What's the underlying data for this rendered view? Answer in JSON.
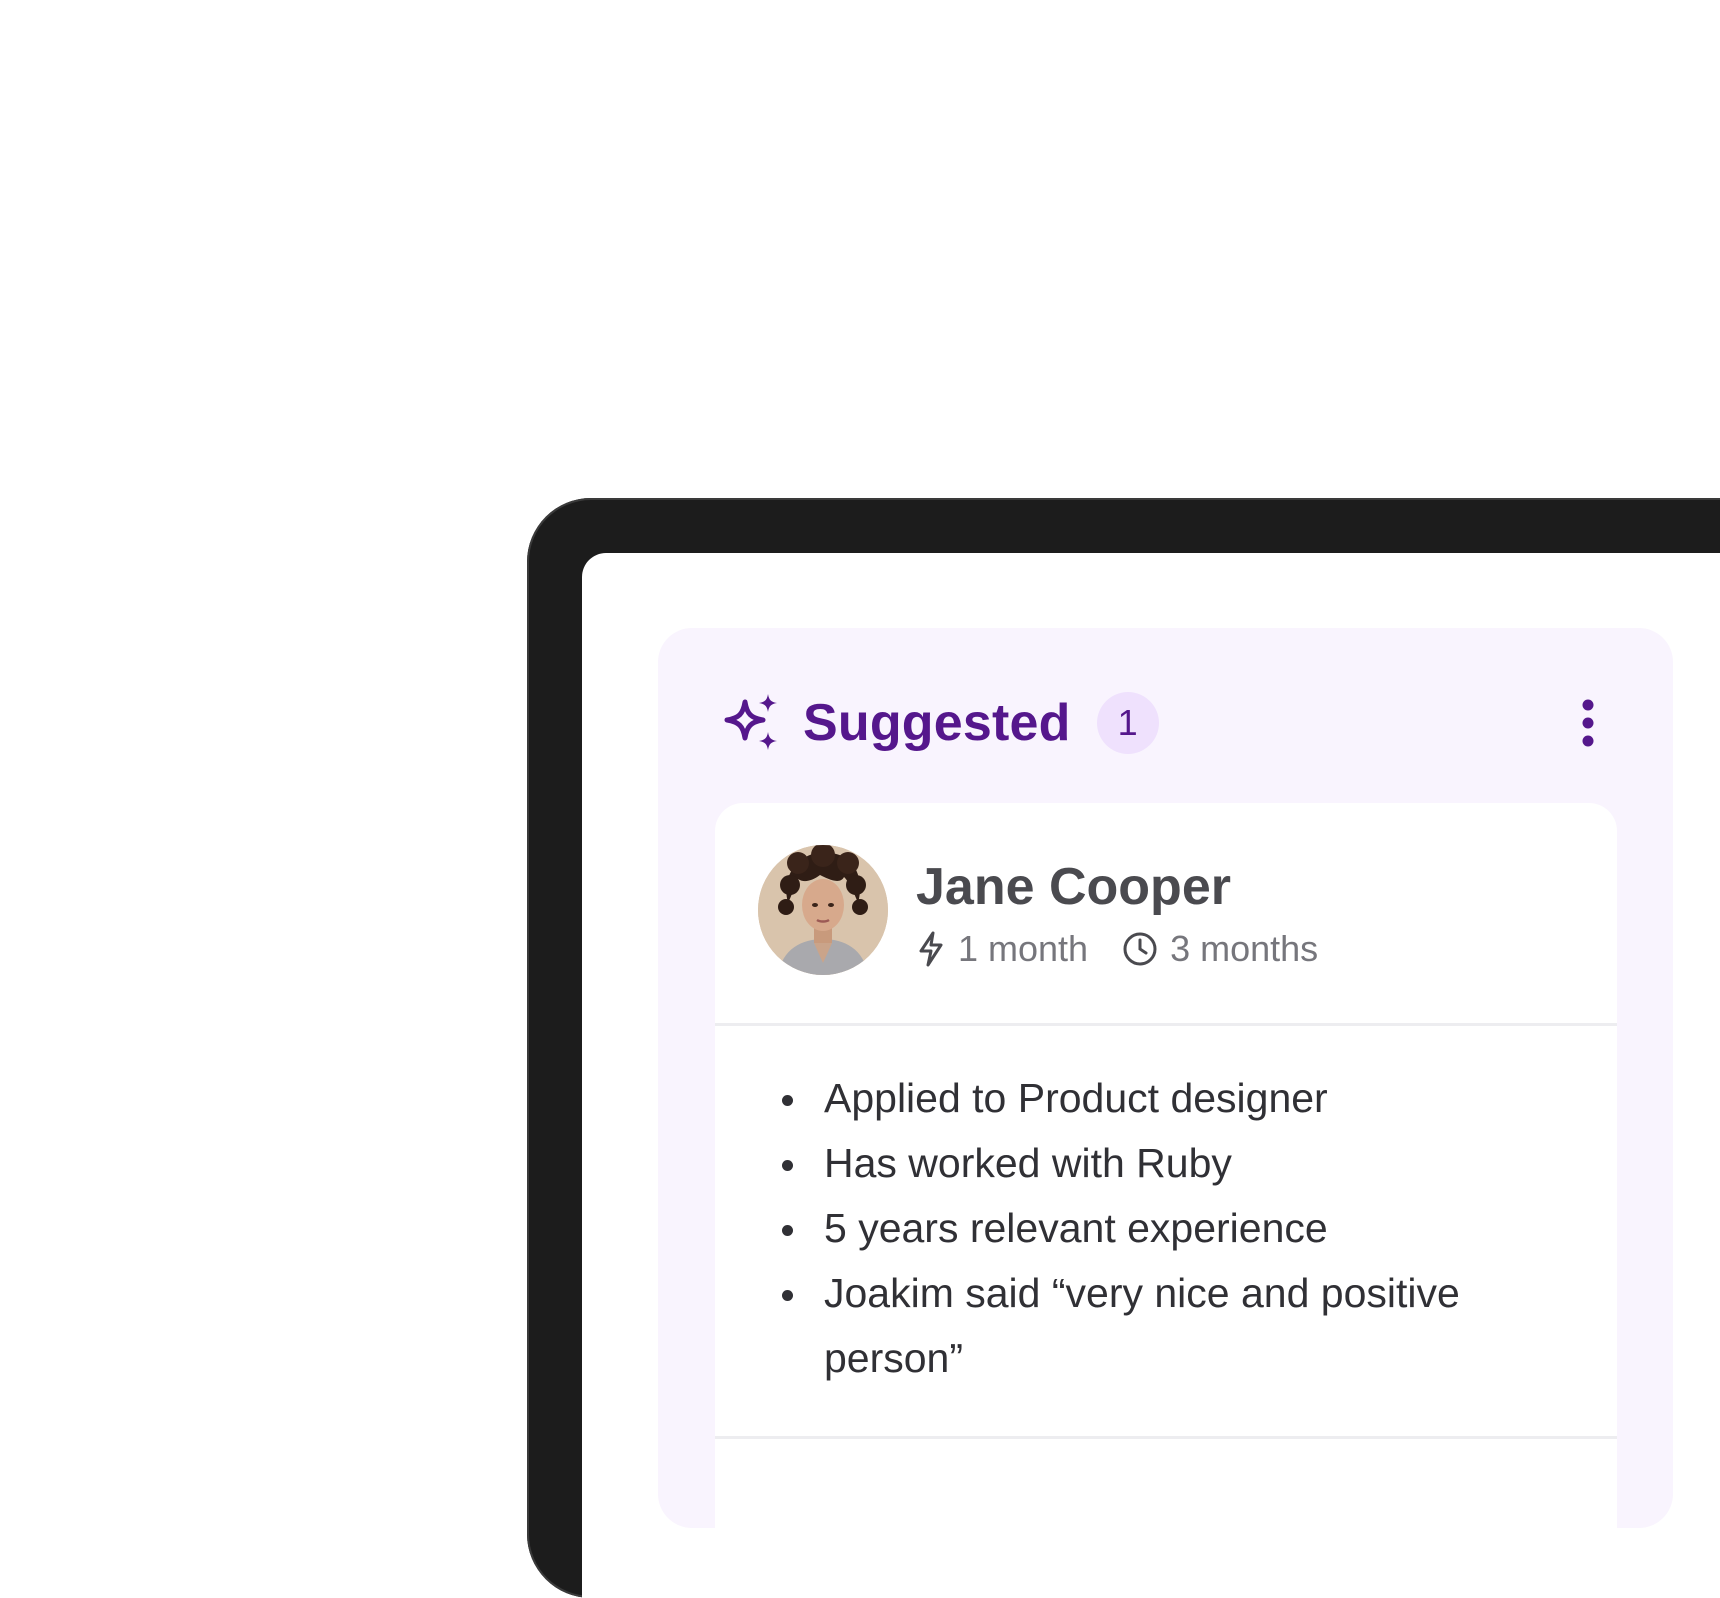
{
  "colors": {
    "accent": "#55178c",
    "accent_light": "#efe1fd",
    "panel_background": "#f9f4fe",
    "device_frame": "#1c1c1c"
  },
  "suggested": {
    "icon": "sparkles-icon",
    "title": "Suggested",
    "count": "1",
    "menu_icon": "more-vertical-icon"
  },
  "candidate": {
    "name": "Jane Cooper",
    "avatar_icon": "avatar-photo",
    "meta": [
      {
        "icon": "lightning-icon",
        "label": "1 month"
      },
      {
        "icon": "clock-icon",
        "label": "3 months"
      }
    ],
    "highlights": [
      "Applied to Product designer",
      "Has worked with Ruby",
      "5 years relevant experience",
      "Joakim said “very nice and positive person”"
    ]
  }
}
